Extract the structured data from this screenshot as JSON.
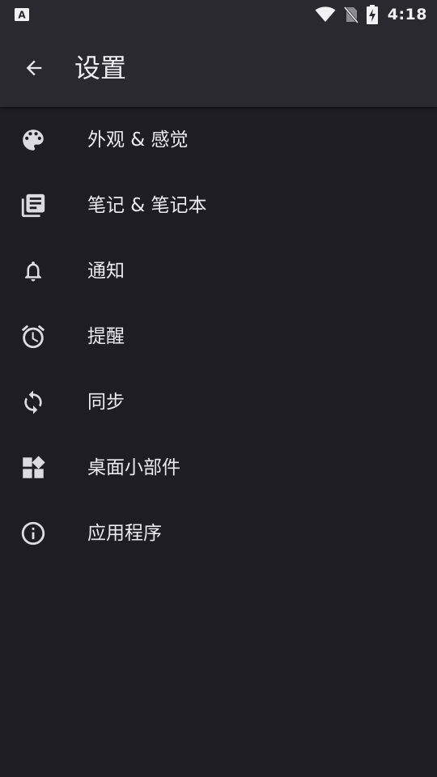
{
  "status_bar": {
    "left_icon": "a-notification-icon",
    "icons": [
      "wifi-icon",
      "no-sim-icon",
      "battery-charging-icon"
    ],
    "time": "4:18"
  },
  "toolbar": {
    "back_icon": "arrow-back-icon",
    "title": "设置"
  },
  "settings": {
    "items": [
      {
        "label": "外观 & 感觉",
        "icon": "palette-icon"
      },
      {
        "label": "笔记 & 笔记本",
        "icon": "library-books-icon"
      },
      {
        "label": "通知",
        "icon": "bell-icon"
      },
      {
        "label": "提醒",
        "icon": "alarm-icon"
      },
      {
        "label": "同步",
        "icon": "sync-icon"
      },
      {
        "label": "桌面小部件",
        "icon": "widgets-icon"
      },
      {
        "label": "应用程序",
        "icon": "info-icon"
      }
    ]
  },
  "colors": {
    "background": "#1e1d23",
    "toolbar": "#2a2930",
    "text": "#ecebf0",
    "icon": "#dcdbe2"
  }
}
